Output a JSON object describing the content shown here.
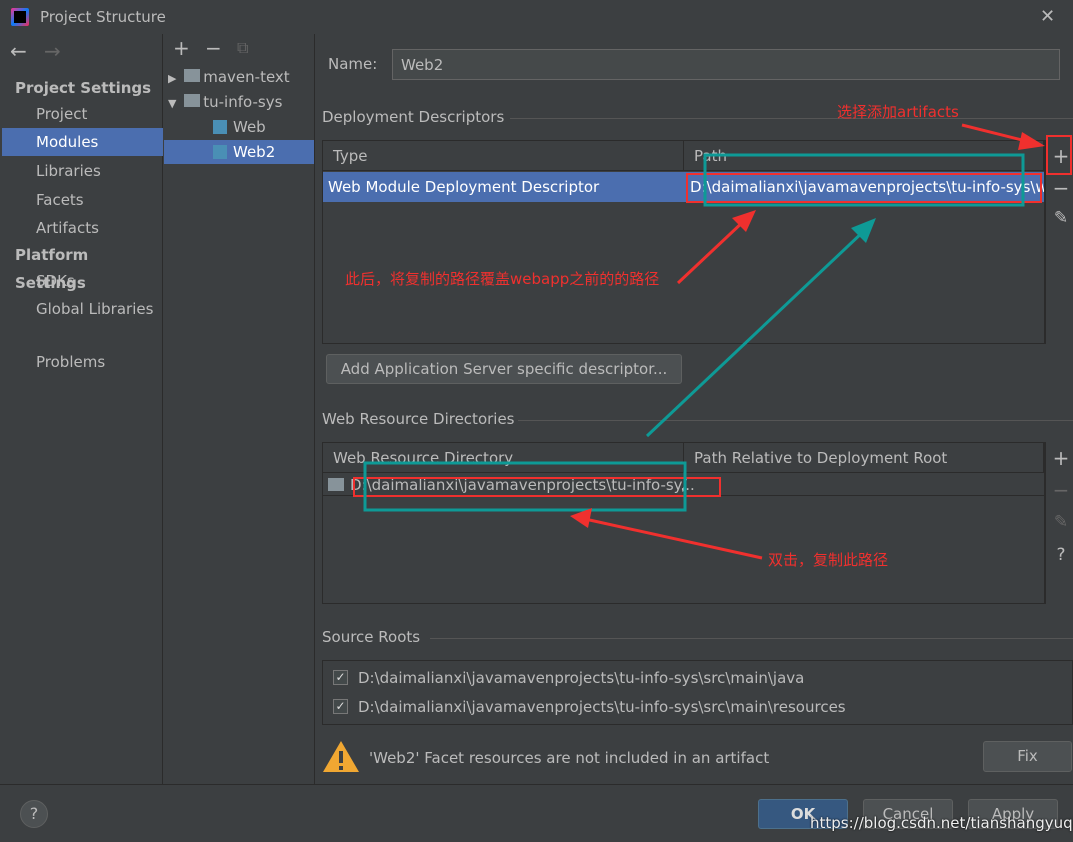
{
  "window": {
    "title": "Project Structure",
    "close": "✕"
  },
  "sidebar": {
    "back": "←",
    "forward": "→",
    "items": [
      {
        "label": "Project Settings",
        "header": true
      },
      {
        "label": "Project"
      },
      {
        "label": "Modules",
        "selected": true
      },
      {
        "label": "Libraries"
      },
      {
        "label": "Facets"
      },
      {
        "label": "Artifacts"
      },
      {
        "label": "Platform Settings",
        "header": true
      },
      {
        "label": "SDKs"
      },
      {
        "label": "Global Libraries"
      },
      {
        "label": "Problems"
      }
    ]
  },
  "tree": {
    "add": "+",
    "remove": "−",
    "copy": "⧉",
    "items": [
      {
        "label": "maven-text",
        "arrow": "▶"
      },
      {
        "label": "tu-info-sys",
        "arrow": "▼"
      },
      {
        "label": "Web"
      },
      {
        "label": "Web2",
        "selected": true
      }
    ]
  },
  "name": {
    "label": "Name:",
    "value": "Web2"
  },
  "deployment": {
    "title": "Deployment Descriptors",
    "columns": [
      "Type",
      "Path"
    ],
    "rows": [
      {
        "type": "Web Module Deployment Descriptor",
        "path": "D:\\daimalianxi\\javamavenprojects\\tu-info-sys\\we"
      }
    ],
    "add_server_button": "Add Application Server specific descriptor..."
  },
  "web_resources": {
    "title": "Web Resource Directories",
    "columns": [
      "Web Resource Directory",
      "Path Relative to Deployment Root"
    ],
    "rows": [
      {
        "dir": "D:\\daimalianxi\\javamavenprojects\\tu-info-sy...",
        "rel": "/"
      }
    ]
  },
  "source_roots": {
    "title": "Source Roots",
    "items": [
      {
        "path": "D:\\daimalianxi\\javamavenprojects\\tu-info-sys\\src\\main\\java",
        "checked": true
      },
      {
        "path": "D:\\daimalianxi\\javamavenprojects\\tu-info-sys\\src\\main\\resources",
        "checked": true
      }
    ]
  },
  "warning": {
    "text": "'Web2' Facet resources are not included in an artifact",
    "fix": "Fix"
  },
  "footer": {
    "help": "?",
    "ok": "OK",
    "cancel": "Cancel",
    "apply": "Apply"
  },
  "annotations": {
    "select_artifacts": "选择添加artifacts",
    "overwrite": "此后，将复制的路径覆盖webapp之前的的路径",
    "double_click": "双击，复制此路径",
    "watermark": "https://blog.csdn.net/tianshangyuqin"
  },
  "colors": {
    "selection": "#4b6eaf",
    "annotation_red": "#f0302e",
    "annotation_teal": "#0e9a96"
  }
}
